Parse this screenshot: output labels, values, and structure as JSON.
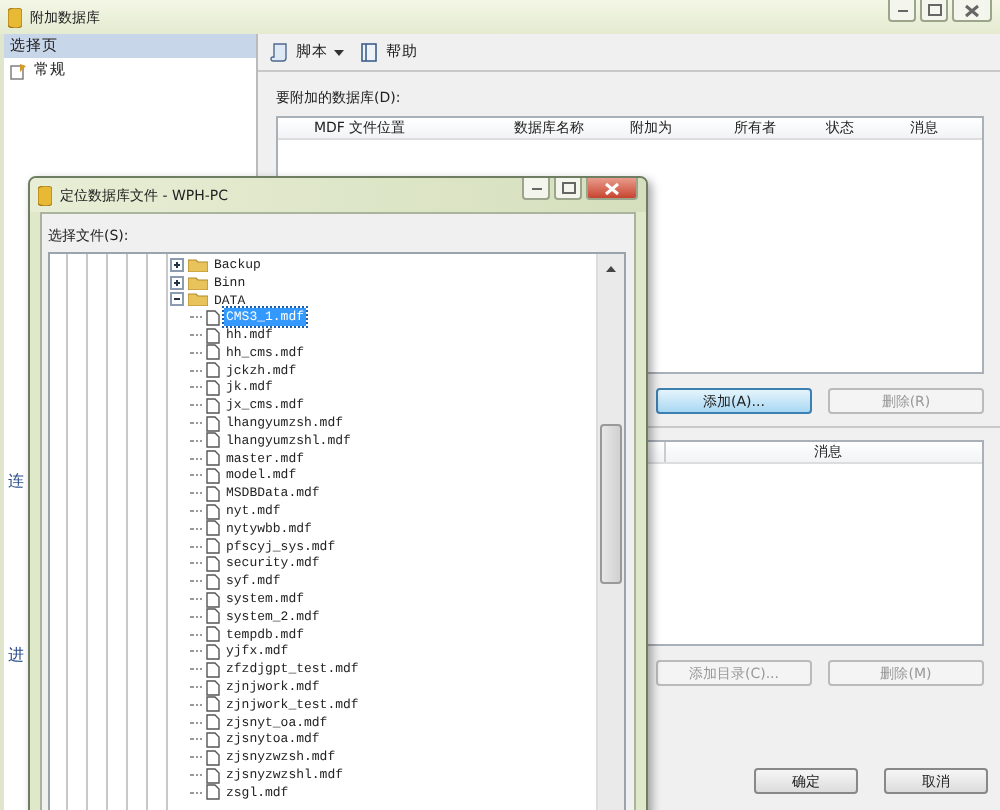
{
  "window": {
    "title": "附加数据库"
  },
  "sidebar": {
    "heading": "选择页",
    "items": [
      {
        "label": "常规"
      }
    ],
    "cut_headings": [
      "连",
      "进"
    ]
  },
  "toolbar": [
    {
      "label": "脚本",
      "has_menu": true,
      "kind": "script"
    },
    {
      "label": "帮助",
      "has_menu": false,
      "kind": "help"
    }
  ],
  "databases": {
    "label": "要附加的数据库(D):",
    "columns": [
      "MDF 文件位置",
      "数据库名称",
      "附加为",
      "所有者",
      "状态",
      "消息"
    ]
  },
  "database_buttons": [
    {
      "label": "添加(A)...",
      "disabled": false,
      "focused": true
    },
    {
      "label": "删除(R)",
      "disabled": true,
      "focused": false
    }
  ],
  "details": {
    "columns": [
      "消息"
    ]
  },
  "details_buttons": [
    {
      "label": "添加目录(C)...",
      "disabled": true,
      "focused": false
    },
    {
      "label": "删除(M)",
      "disabled": true,
      "focused": false
    }
  ],
  "footer_buttons": [
    "确定",
    "取消"
  ],
  "dialog": {
    "title": "定位数据库文件 - WPH-PC",
    "label": "选择文件(S):",
    "tree": [
      {
        "label": "Backup",
        "kind": "folder",
        "expanded": false,
        "selected": false
      },
      {
        "label": "Binn",
        "kind": "folder",
        "expanded": false,
        "selected": false
      },
      {
        "label": "DATA",
        "kind": "folder",
        "expanded": true,
        "selected": false,
        "children": [
          {
            "label": "CMS3_1.mdf",
            "kind": "file",
            "selected": true
          },
          {
            "label": "hh.mdf",
            "kind": "file",
            "selected": false
          },
          {
            "label": "hh_cms.mdf",
            "kind": "file",
            "selected": false
          },
          {
            "label": "jckzh.mdf",
            "kind": "file",
            "selected": false
          },
          {
            "label": "jk.mdf",
            "kind": "file",
            "selected": false
          },
          {
            "label": "jx_cms.mdf",
            "kind": "file",
            "selected": false
          },
          {
            "label": "lhangyumzsh.mdf",
            "kind": "file",
            "selected": false
          },
          {
            "label": "lhangyumzshl.mdf",
            "kind": "file",
            "selected": false
          },
          {
            "label": "master.mdf",
            "kind": "file",
            "selected": false
          },
          {
            "label": "model.mdf",
            "kind": "file",
            "selected": false
          },
          {
            "label": "MSDBData.mdf",
            "kind": "file",
            "selected": false
          },
          {
            "label": "nyt.mdf",
            "kind": "file",
            "selected": false
          },
          {
            "label": "nytywbb.mdf",
            "kind": "file",
            "selected": false
          },
          {
            "label": "pfscyj_sys.mdf",
            "kind": "file",
            "selected": false
          },
          {
            "label": "security.mdf",
            "kind": "file",
            "selected": false
          },
          {
            "label": "syf.mdf",
            "kind": "file",
            "selected": false
          },
          {
            "label": "system.mdf",
            "kind": "file",
            "selected": false
          },
          {
            "label": "system_2.mdf",
            "kind": "file",
            "selected": false
          },
          {
            "label": "tempdb.mdf",
            "kind": "file",
            "selected": false
          },
          {
            "label": "yjfx.mdf",
            "kind": "file",
            "selected": false
          },
          {
            "label": "zfzdjgpt_test.mdf",
            "kind": "file",
            "selected": false
          },
          {
            "label": "zjnjwork.mdf",
            "kind": "file",
            "selected": false
          },
          {
            "label": "zjnjwork_test.mdf",
            "kind": "file",
            "selected": false
          },
          {
            "label": "zjsnyt_oa.mdf",
            "kind": "file",
            "selected": false
          },
          {
            "label": "zjsnytoa.mdf",
            "kind": "file",
            "selected": false
          },
          {
            "label": "zjsnyzwzsh.mdf",
            "kind": "file",
            "selected": false
          },
          {
            "label": "zjsnyzwzshl.mdf",
            "kind": "file",
            "selected": false
          },
          {
            "label": "zsgl.mdf",
            "kind": "file",
            "selected": false
          }
        ]
      }
    ]
  }
}
